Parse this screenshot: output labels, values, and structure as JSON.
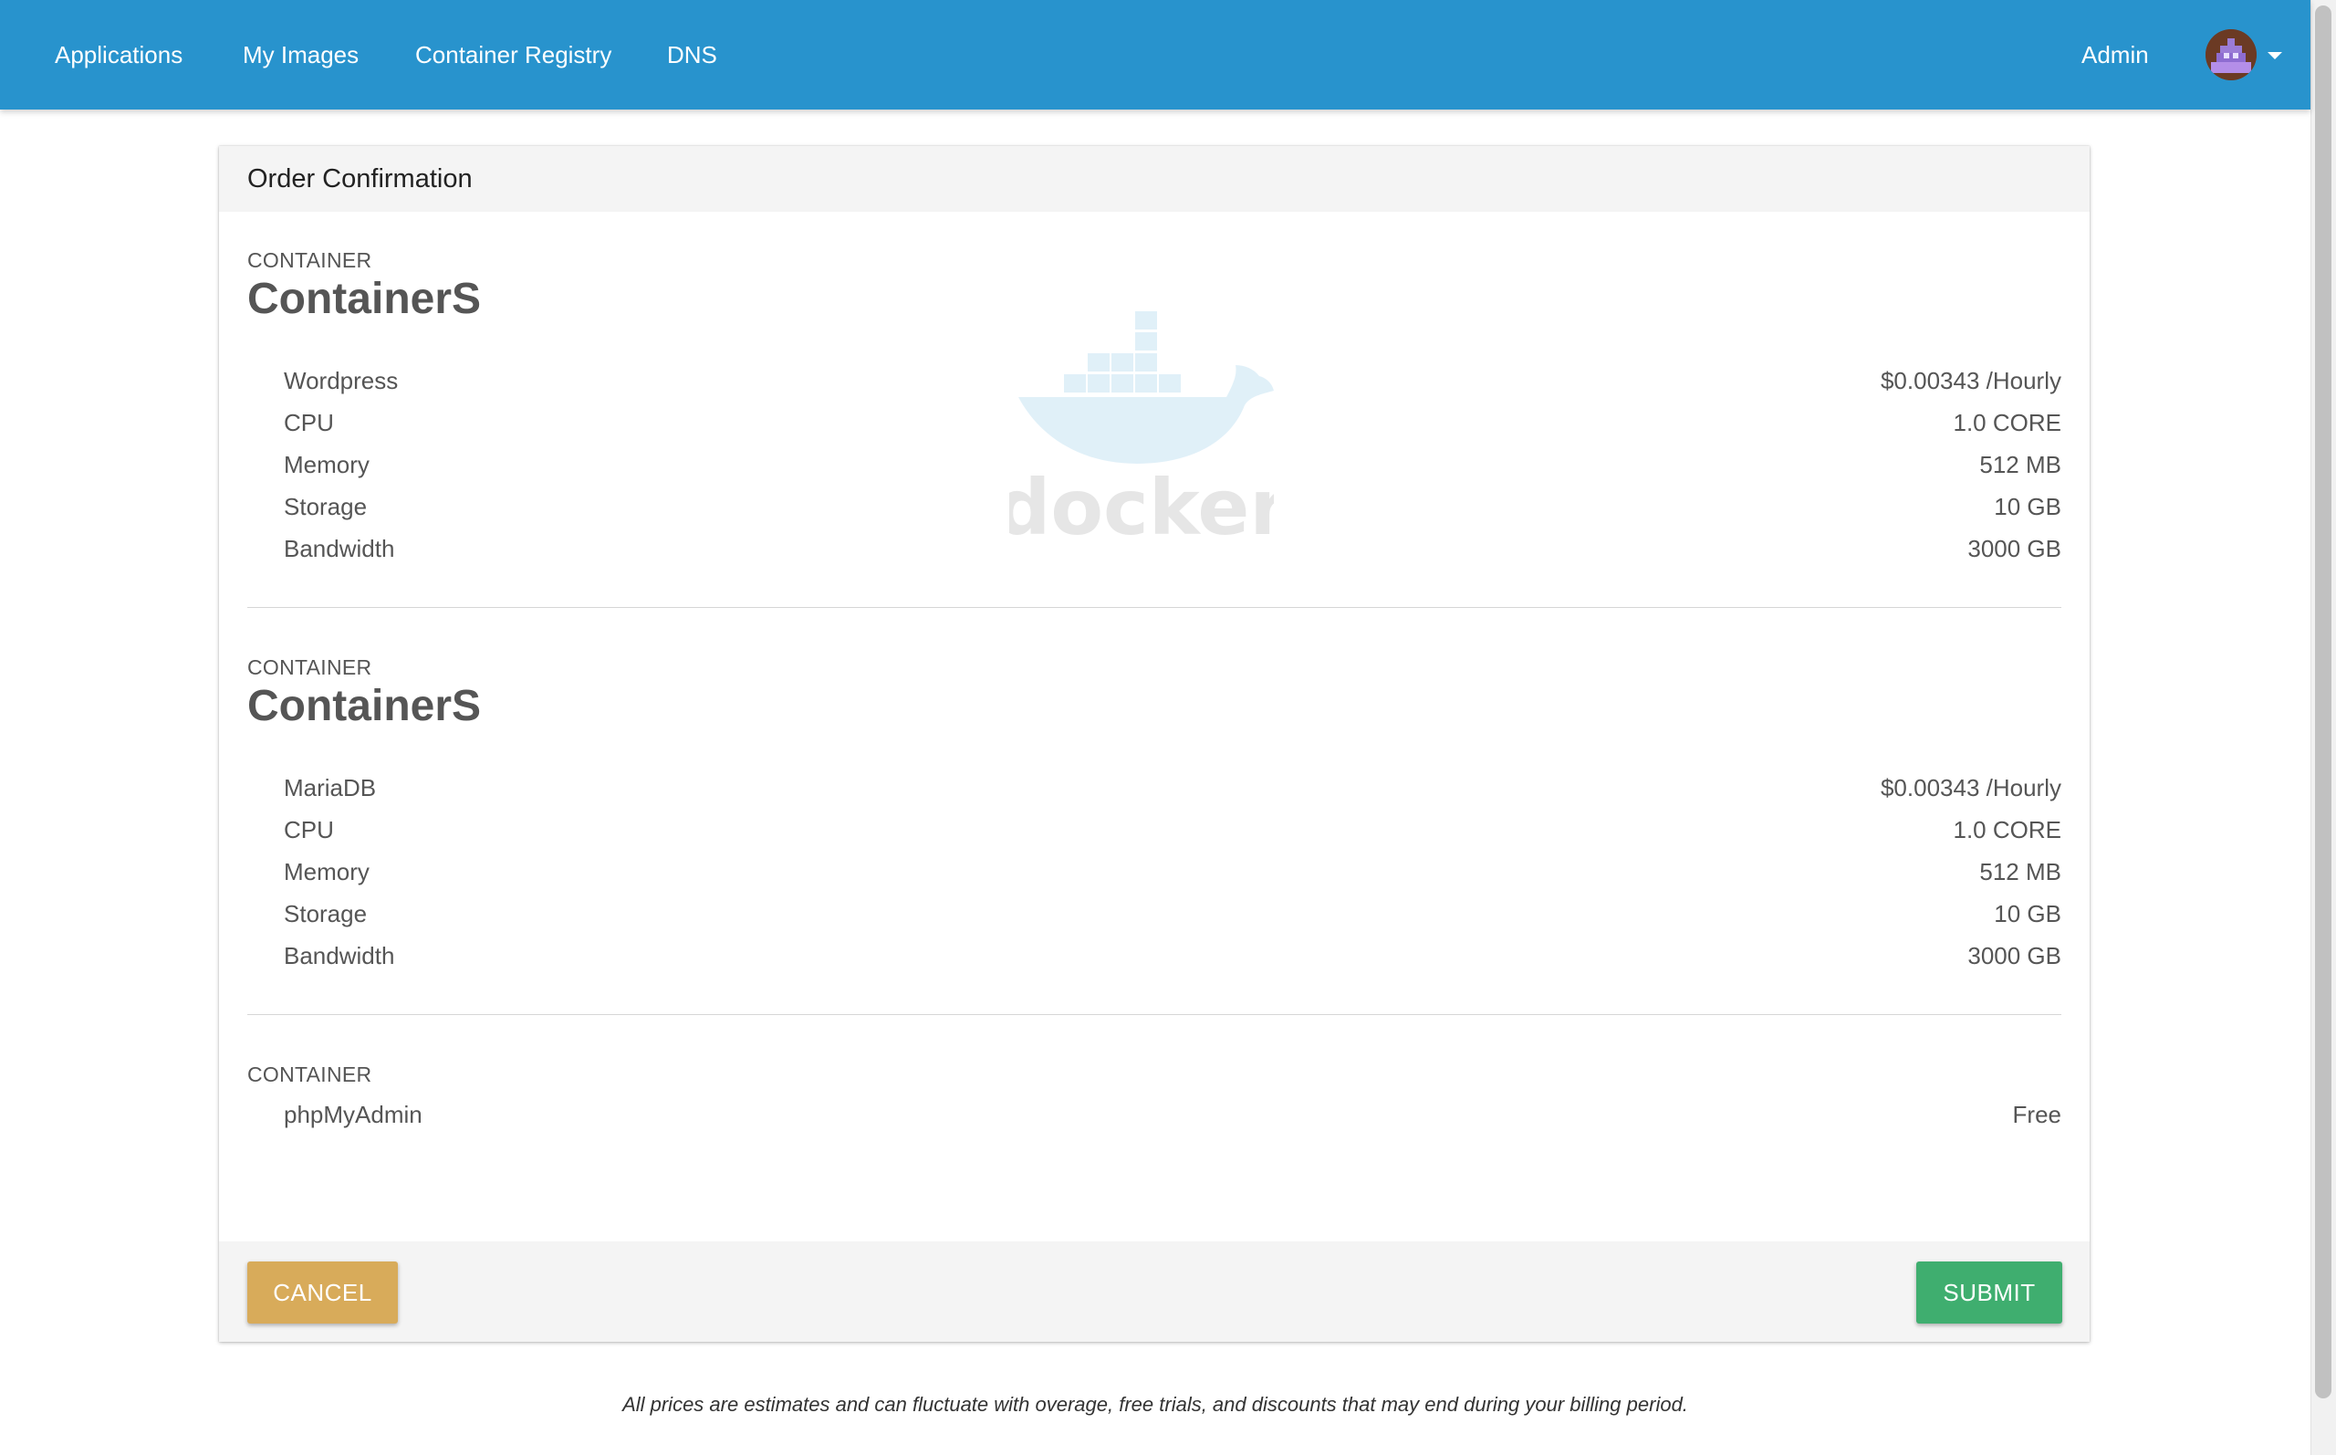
{
  "nav": {
    "links": [
      "Applications",
      "My Images",
      "Container Registry",
      "DNS"
    ],
    "user": "Admin",
    "avatar_icon": "user-avatar-icon",
    "brand_color": "#2893cd"
  },
  "card": {
    "title": "Order Confirmation",
    "watermark_text": "docker",
    "sections": [
      {
        "label": "CONTAINER",
        "name": "ContainerS",
        "rows": [
          {
            "label": "Wordpress",
            "value": "$0.00343 /Hourly"
          },
          {
            "label": "CPU",
            "value": "1.0 CORE"
          },
          {
            "label": "Memory",
            "value": "512 MB"
          },
          {
            "label": "Storage",
            "value": "10 GB"
          },
          {
            "label": "Bandwidth",
            "value": "3000 GB"
          }
        ]
      },
      {
        "label": "CONTAINER",
        "name": "ContainerS",
        "rows": [
          {
            "label": "MariaDB",
            "value": "$0.00343 /Hourly"
          },
          {
            "label": "CPU",
            "value": "1.0 CORE"
          },
          {
            "label": "Memory",
            "value": "512 MB"
          },
          {
            "label": "Storage",
            "value": "10 GB"
          },
          {
            "label": "Bandwidth",
            "value": "3000 GB"
          }
        ]
      },
      {
        "label": "CONTAINER",
        "rows": [
          {
            "label": "phpMyAdmin",
            "value": "Free"
          }
        ]
      }
    ]
  },
  "actions": {
    "cancel": "CANCEL",
    "submit": "SUBMIT",
    "cancel_color": "#d8ab5a",
    "submit_color": "#3fae6f"
  },
  "footer": {
    "disclaimer": "All prices are estimates and can fluctuate with overage, free trials, and discounts that may end during your billing period."
  }
}
